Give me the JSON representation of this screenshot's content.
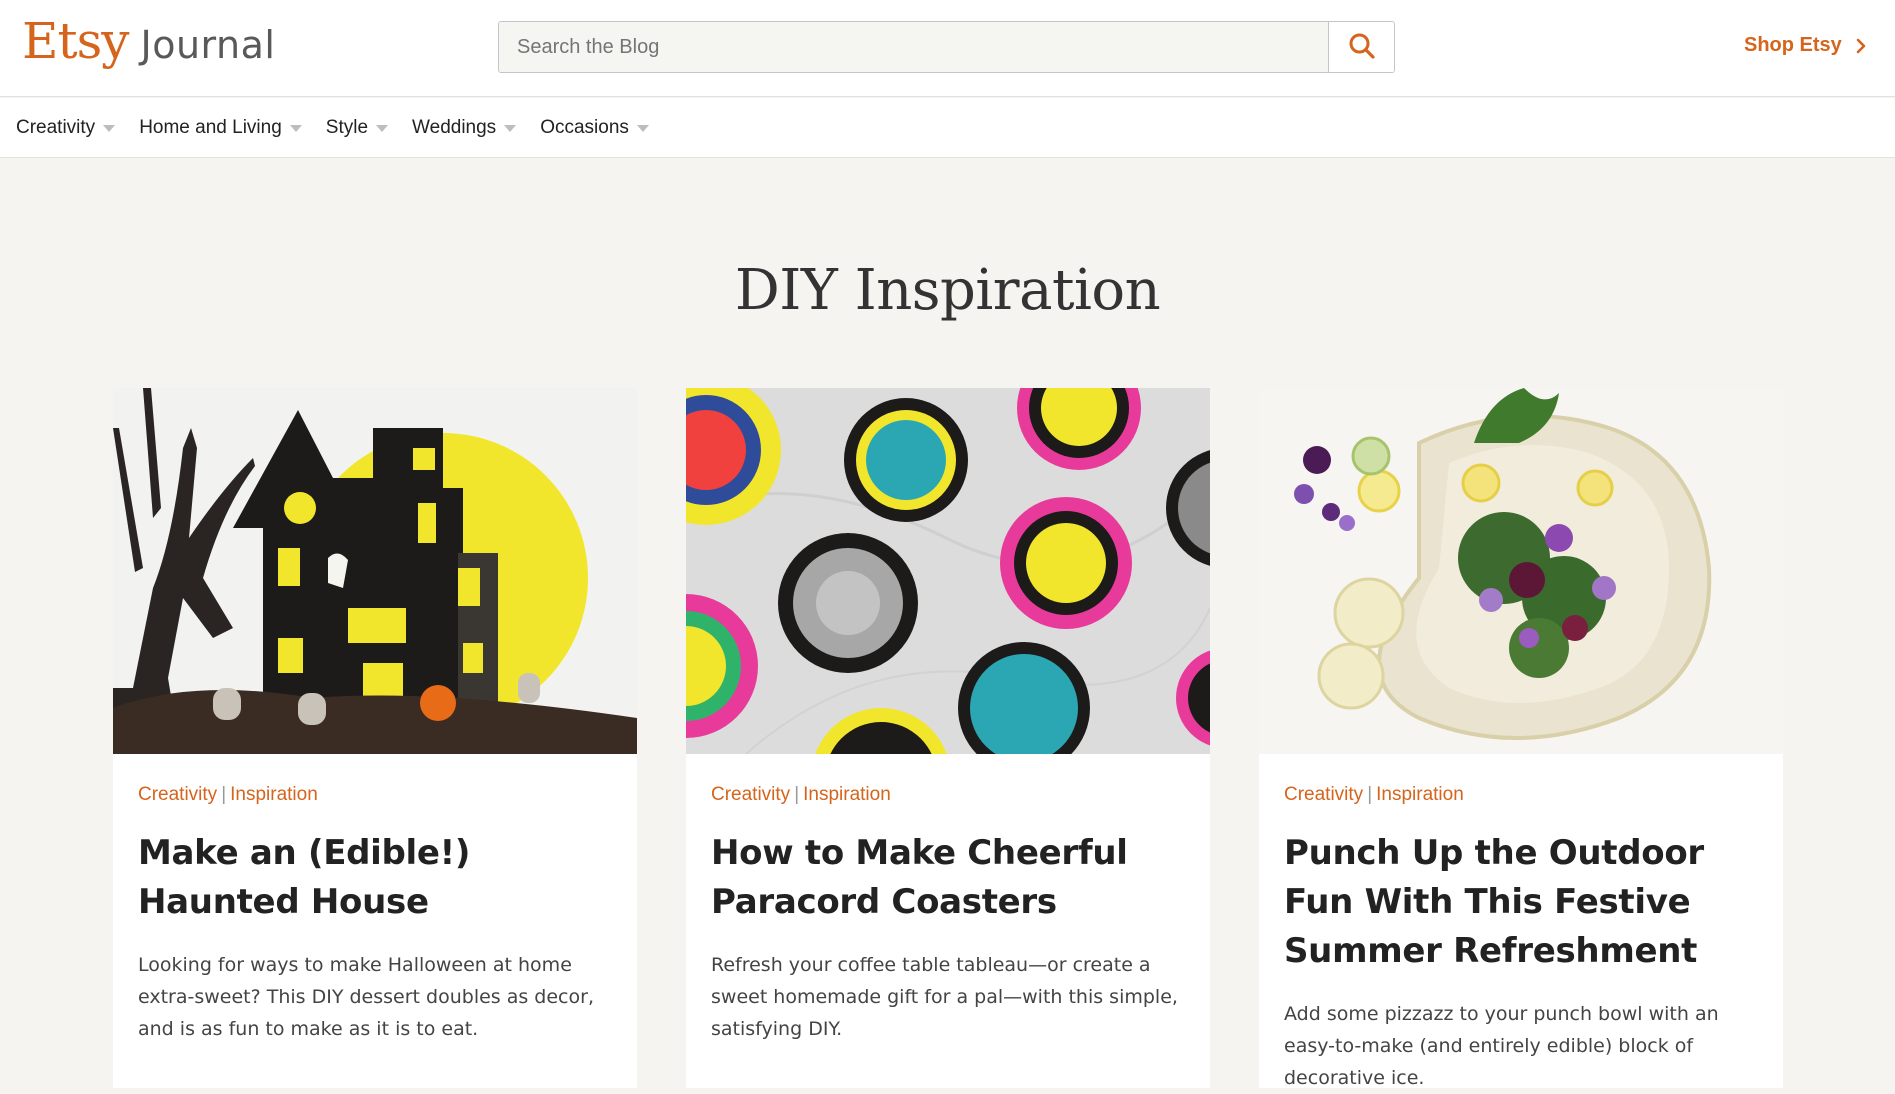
{
  "header": {
    "logo_primary": "Etsy",
    "logo_secondary": "Journal",
    "search_placeholder": "Search the Blog",
    "search_icon": "search-icon",
    "shop_link_label": "Shop Etsy",
    "shop_link_icon": "chevron-right-icon"
  },
  "nav": {
    "items": [
      {
        "label": "Creativity"
      },
      {
        "label": "Home and Living"
      },
      {
        "label": "Style"
      },
      {
        "label": "Weddings"
      },
      {
        "label": "Occasions"
      }
    ]
  },
  "main": {
    "title": "DIY Inspiration",
    "cards": [
      {
        "category": "Creativity",
        "subcategory": "Inspiration",
        "separator": "|",
        "title": "Make an (Edible!) Haunted House",
        "description": "Looking for ways to make Halloween at home extra-sweet? This DIY dessert doubles as decor, and is as fun to make as it is to eat.",
        "image_alt": "Black haunted house cake with yellow moon"
      },
      {
        "category": "Creativity",
        "subcategory": "Inspiration",
        "separator": "|",
        "title": "How to Make Cheerful Paracord Coasters",
        "description": "Refresh your coffee table tableau—or create a sweet homemade gift for a pal—with this simple, satisfying DIY.",
        "image_alt": "Colorful paracord coasters on marble"
      },
      {
        "category": "Creativity",
        "subcategory": "Inspiration",
        "separator": "|",
        "title": "Punch Up the Outdoor Fun With This Festive Summer Refreshment",
        "description": "Add some pizzazz to your punch bowl with an easy-to-make (and entirely edible) block of decorative ice.",
        "image_alt": "Glass punch bowl with flowers and lemons"
      }
    ]
  },
  "colors": {
    "brand_orange": "#d5641c",
    "page_background": "#f5f4f1",
    "text_dark": "#222222"
  }
}
